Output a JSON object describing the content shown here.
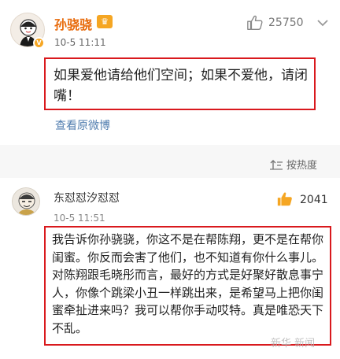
{
  "post": {
    "author": "孙骁骁",
    "time": "10-5 11:11",
    "likes": "25750",
    "badge_icon": "crown-icon",
    "text": "如果爱他请给他们空间；如果不爱他，请闭嘴！",
    "view_original": "查看原微博"
  },
  "sort": {
    "label": "按热度"
  },
  "comment": {
    "author": "东怼怼汐怼怼",
    "time": "10-5 11:51",
    "likes": "2041",
    "text": "我告诉你孙骁骁，你这不是在帮陈翔，更不是在帮你闺蜜。你反而会害了他们，也不知道有你什么事儿。对陈翔跟毛晓彤而言，最好的方式是好聚好散息事宁人，你像个跳梁小丑一样跳出来，是希望马上把你闺蜜牵扯进来吗？我可以帮你手动哎特。真是唯恐天下不乱。"
  },
  "watermark": {
    "text": "新华 新闻"
  },
  "colors": {
    "accent_orange": "#e86b0c",
    "highlight_red": "#d9191d",
    "link_blue": "#507daf"
  }
}
